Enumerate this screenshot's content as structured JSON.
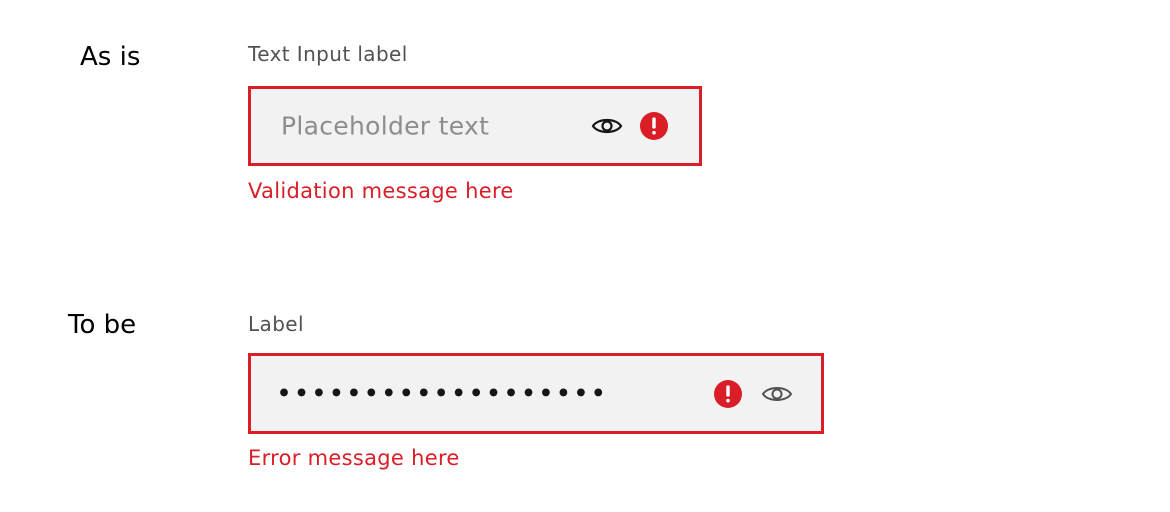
{
  "as_is": {
    "section_label": "As is",
    "field_label": "Text Input label",
    "placeholder": "Placeholder text",
    "validation_message": "Validation message here",
    "icons": [
      "eye-icon",
      "warning-filled-icon"
    ]
  },
  "to_be": {
    "section_label": "To be",
    "field_label": "Label",
    "masked_value": "•••••••••••••••••••",
    "error_message": "Error message here",
    "icons": [
      "warning-filled-icon",
      "eye-icon"
    ]
  },
  "colors": {
    "error": "#da1e28",
    "field_background": "#f2f2f2",
    "label_text": "#525252",
    "placeholder_text": "#8d8d8d"
  }
}
